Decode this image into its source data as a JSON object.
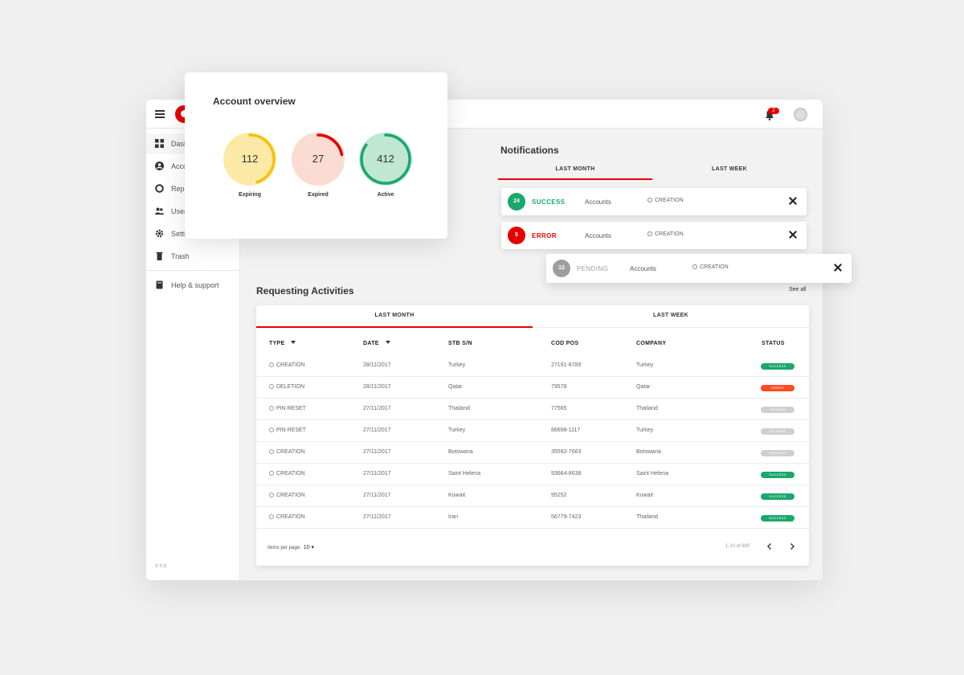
{
  "topbar": {
    "notification_count": "2"
  },
  "sidebar": {
    "items": [
      {
        "label": "Dashboard",
        "icon": "grid-icon"
      },
      {
        "label": "Accounts",
        "icon": "account-icon"
      },
      {
        "label": "Reports",
        "icon": "donut-chart-icon"
      },
      {
        "label": "Users",
        "icon": "users-icon"
      },
      {
        "label": "Settings",
        "icon": "gear-icon"
      },
      {
        "label": "Trash",
        "icon": "trash-icon"
      }
    ],
    "help": {
      "label": "Help & support",
      "icon": "book-icon"
    },
    "version": "V 0.9"
  },
  "account_overview": {
    "title": "Account overview",
    "gauges": [
      {
        "value": "112",
        "label": "Expiring",
        "fill_color": "#fde9a6",
        "ring_color": "#f4c20d",
        "progress": 0.45
      },
      {
        "value": "27",
        "label": "Expired",
        "fill_color": "#fbdcd2",
        "ring_color": "#e60000",
        "progress": 0.22
      },
      {
        "value": "412",
        "label": "Active",
        "fill_color": "#bfe7d3",
        "ring_color": "#1aa86b",
        "progress": 0.85
      }
    ]
  },
  "notifications": {
    "title": "Notifications",
    "tabs": [
      "LAST MONTH",
      "LAST WEEK"
    ],
    "items": [
      {
        "count": "24",
        "status": "SUCCESS",
        "accounts": "Accounts",
        "type": "CREATION",
        "color": "#1aa86b"
      },
      {
        "count": "5",
        "status": "ERROR",
        "accounts": "Accounts",
        "type": "CREATION",
        "color": "#e60000"
      },
      {
        "count": "12",
        "status": "PENDING",
        "accounts": "Accounts",
        "type": "CREATION",
        "color": "#9e9e9e"
      }
    ]
  },
  "activities": {
    "title": "Requesting Activities",
    "see_all": "See all",
    "tabs": [
      "LAST MONTH",
      "LAST WEEK"
    ],
    "columns": [
      "TYPE",
      "DATE",
      "STB S/N",
      "COD POS",
      "COMPANY",
      "STATUS"
    ],
    "rows": [
      {
        "type": "CREATION",
        "date": "28/11/2017",
        "stb": "Turkey",
        "cod": "27191-8789",
        "company": "Turkey",
        "status": "SUCCESS",
        "status_color": "#1aa86b"
      },
      {
        "type": "DELETION",
        "date": "28/11/2017",
        "stb": "Qatar",
        "cod": "79578",
        "company": "Qatar",
        "status": "ERROR",
        "status_color": "#ff4b1f"
      },
      {
        "type": "PIN RESET",
        "date": "27/11/2017",
        "stb": "Thailand",
        "cod": "77565",
        "company": "Thailand",
        "status": "PENDING",
        "status_color": "#cfcfcf"
      },
      {
        "type": "PIN RESET",
        "date": "27/11/2017",
        "stb": "Turkey",
        "cod": "86698-1117",
        "company": "Turkey",
        "status": "PENDING",
        "status_color": "#cfcfcf"
      },
      {
        "type": "CREATION",
        "date": "27/11/2017",
        "stb": "Botswana",
        "cod": "35592-7663",
        "company": "Botswana",
        "status": "PENDING",
        "status_color": "#cfcfcf"
      },
      {
        "type": "CREATION",
        "date": "27/11/2017",
        "stb": "Saint Helena",
        "cod": "93664-8638",
        "company": "Saint Helena",
        "status": "SUCCESS",
        "status_color": "#1aa86b"
      },
      {
        "type": "CREATION",
        "date": "27/11/2017",
        "stb": "Kuwait",
        "cod": "95252",
        "company": "Kuwait",
        "status": "SUCCESS",
        "status_color": "#1aa86b"
      },
      {
        "type": "CREATION",
        "date": "27/11/2017",
        "stb": "Iran",
        "cod": "56779-7423",
        "company": "Thailand",
        "status": "SUCCESS",
        "status_color": "#1aa86b"
      }
    ],
    "items_per_page_label": "Items per page:",
    "items_per_page_value": "10",
    "range": "1-10 of 600"
  },
  "colors": {
    "brand": "#e60000",
    "success": "#1aa86b",
    "error": "#e60000",
    "pending": "#9e9e9e"
  }
}
